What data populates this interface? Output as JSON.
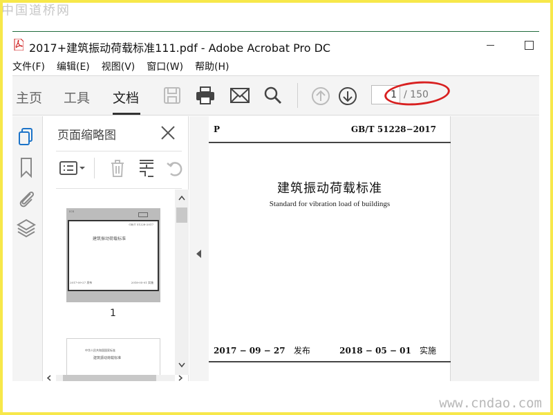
{
  "watermark_top": "中国道桥网",
  "watermark_bottom": "www.cndao.com",
  "window": {
    "title": "2017+建筑振动荷载标准111.pdf - Adobe Acrobat Pro DC"
  },
  "menu": [
    "文件(F)",
    "编辑(E)",
    "视图(V)",
    "窗口(W)",
    "帮助(H)"
  ],
  "toolbar": {
    "tabs": [
      "主页",
      "工具",
      "文档"
    ],
    "active_tab": "文档",
    "icons": [
      "save-icon",
      "print-icon",
      "email-icon",
      "search-icon",
      "page-up-icon",
      "page-down-icon"
    ],
    "page_current": "1",
    "page_total": "/ 150"
  },
  "annotation_color": "#d82020",
  "rail_icons": [
    "pages-icon",
    "bookmark-icon",
    "attachment-icon",
    "layers-icon"
  ],
  "panel": {
    "title": "页面缩略图",
    "thumbnails": [
      {
        "number": "1",
        "code": "GB/T 51228-2017",
        "title": "建筑振动荷载标准",
        "date_issue": "2017-09-27 发布",
        "date_effective": "2018-05-01 实施"
      }
    ],
    "thumb2": {
      "line1": "中华人民共和国国家标准",
      "line2": "建筑振动荷载标准"
    }
  },
  "document": {
    "category": "P",
    "standard_code": "GB/T 51228−2017",
    "title": "建筑振动荷载标准",
    "subtitle": "Standard for vibration load of buildings",
    "issue_date": "2017 − 09 − 27",
    "issue_label": "发布",
    "effective_date": "2018 − 05 − 01",
    "effective_label": "实施"
  }
}
